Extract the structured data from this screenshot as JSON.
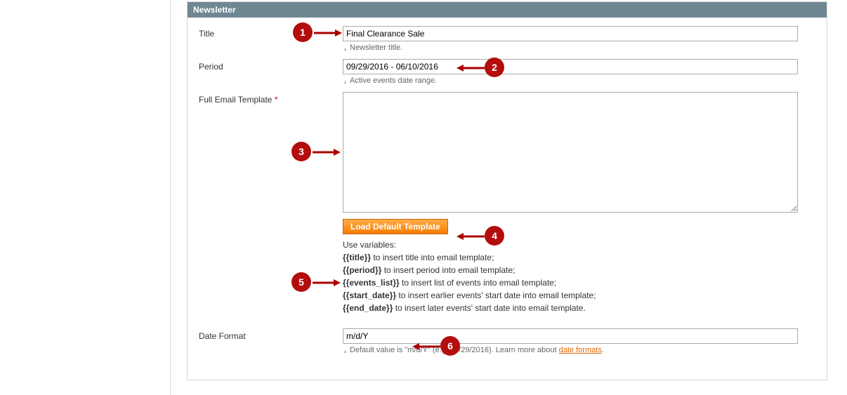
{
  "panel": {
    "header": "Newsletter"
  },
  "fields": {
    "title": {
      "label": "Title",
      "value": "Final Clearance Sale",
      "hint": "Newsletter title."
    },
    "period": {
      "label": "Period",
      "value": "09/29/2016 - 06/10/2016",
      "hint": "Active events date range."
    },
    "template": {
      "label": "Full Email Template",
      "required_mark": "*",
      "value": "",
      "button": "Load Default Template",
      "vars_intro": "Use variables:",
      "vars": [
        {
          "token": "{{title}}",
          "desc": " to insert title into email template;"
        },
        {
          "token": "{{period}}",
          "desc": " to insert period into email template;"
        },
        {
          "token": "{{events_list}}",
          "desc": " to insert list of events into email template;"
        },
        {
          "token": "{{start_date}}",
          "desc": " to insert earlier events' start date into email template;"
        },
        {
          "token": "{{end_date}}",
          "desc": " to insert later events' start date into email template."
        }
      ]
    },
    "dateformat": {
      "label": "Date Format",
      "value": "m/d/Y",
      "hint_pre": "Default value is \"m/d/Y\" (e.g. 09/29/2016). Learn more about ",
      "hint_link": "date formats",
      "hint_post": "."
    }
  },
  "annotations": {
    "b1": "1",
    "b2": "2",
    "b3": "3",
    "b4": "4",
    "b5": "5",
    "b6": "6"
  }
}
